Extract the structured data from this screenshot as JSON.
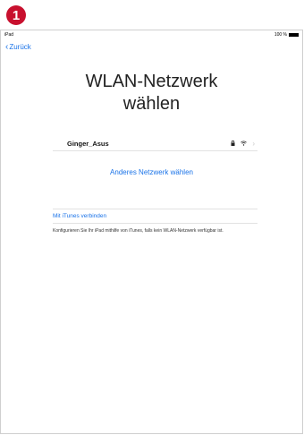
{
  "step_number": "1",
  "status": {
    "device": "iPad",
    "battery_text": "100 %"
  },
  "nav": {
    "back_label": "Zurück"
  },
  "title": {
    "line1": "WLAN-Netzwerk",
    "line2": "wählen"
  },
  "network": {
    "name": "Ginger_Asus",
    "secured": true
  },
  "other_network_label": "Anderes Netzwerk wählen",
  "itunes_link": "Mit iTunes verbinden",
  "hint_text": "Konfigurieren Sie Ihr iPad mithilfe von iTunes, falls kein WLAN-Netzwerk verfügbar ist.",
  "colors": {
    "accent": "#1a73e8",
    "badge": "#c8102e"
  },
  "icons": [
    "chevron-left-icon",
    "lock-icon",
    "wifi-icon",
    "chevron-right-icon",
    "battery-icon"
  ]
}
